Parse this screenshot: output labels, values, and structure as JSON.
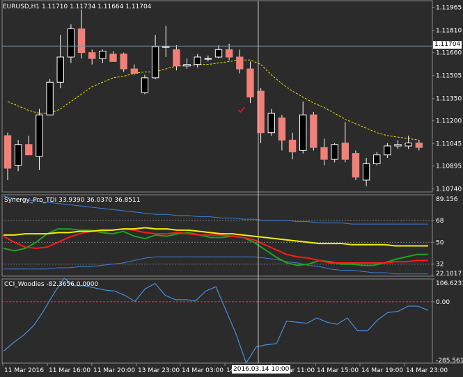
{
  "main_header": {
    "symbol": "EURUSD,H1",
    "ohlc": "1.11710 1.11734 1.11664 1.11704"
  },
  "tdi_header": {
    "name": "Synergy_Pro_TDI",
    "values": "33.9390 36.0370 36.8511"
  },
  "cci_header": {
    "name": "CCI_Woodies",
    "values": "-82.3656 0.0000"
  },
  "current_price_label": "1.11704",
  "cursor_time_label": "2016.03.14 10:00",
  "trade_marker_icon": "checkmark-icon",
  "colors": {
    "background": "#2b2b2b",
    "bull_candle": "#ffffff",
    "bear_candle": "#f08078",
    "ma_line": "#e8e800",
    "tdi_band": "#3d7fd9",
    "tdi_red": "#ff1a1a",
    "tdi_green": "#1fa31f",
    "tdi_yellow": "#f2f200",
    "cci_line": "#4a90d9",
    "zero_line": "#ff3030"
  },
  "chart_data": [
    {
      "type": "candlestick",
      "title": "EURUSD,H1",
      "y_ticks": [
        "1.11965",
        "1.11810",
        "1.11660",
        "1.11505",
        "1.11350",
        "1.11200",
        "1.11045",
        "1.10895",
        "1.10740"
      ],
      "ylim": [
        1.1072,
        1.1201
      ],
      "current_price": 1.11704,
      "x_ticks": [
        "11 Mar 2016",
        "11 Mar 16:00",
        "11 Mar 20:00",
        "13 Mar 23:00",
        "14 Mar 03:00",
        "14 Mar 07:00",
        "14 Mar 11:00",
        "14 Mar 15:00",
        "14 Mar 19:00",
        "14 Mar 23:00"
      ],
      "candles": [
        {
          "o": 1.111,
          "h": 1.1112,
          "l": 1.108,
          "c": 1.1088
        },
        {
          "o": 1.109,
          "h": 1.1107,
          "l": 1.1086,
          "c": 1.1104
        },
        {
          "o": 1.1104,
          "h": 1.111,
          "l": 1.1098,
          "c": 1.1097
        },
        {
          "o": 1.1096,
          "h": 1.1128,
          "l": 1.1087,
          "c": 1.1124
        },
        {
          "o": 1.1124,
          "h": 1.1148,
          "l": 1.1124,
          "c": 1.1146
        },
        {
          "o": 1.1146,
          "h": 1.1178,
          "l": 1.1142,
          "c": 1.1163
        },
        {
          "o": 1.1163,
          "h": 1.1185,
          "l": 1.1159,
          "c": 1.1182
        },
        {
          "o": 1.1182,
          "h": 1.1195,
          "l": 1.1162,
          "c": 1.1166
        },
        {
          "o": 1.1166,
          "h": 1.1168,
          "l": 1.1158,
          "c": 1.1162
        },
        {
          "o": 1.1162,
          "h": 1.1168,
          "l": 1.1159,
          "c": 1.1167
        },
        {
          "o": 1.1165,
          "h": 1.1167,
          "l": 1.116,
          "c": 1.116
        },
        {
          "o": 1.1165,
          "h": 1.1166,
          "l": 1.1153,
          "c": 1.1155
        },
        {
          "o": 1.1155,
          "h": 1.1158,
          "l": 1.1151,
          "c": 1.1152
        },
        {
          "o": 1.1139,
          "h": 1.1151,
          "l": 1.1138,
          "c": 1.1149
        },
        {
          "o": 1.1149,
          "h": 1.1178,
          "l": 1.1148,
          "c": 1.117
        },
        {
          "o": 1.117,
          "h": 1.1184,
          "l": 1.1163,
          "c": 1.117
        },
        {
          "o": 1.1168,
          "h": 1.1171,
          "l": 1.1154,
          "c": 1.1157
        },
        {
          "o": 1.1157,
          "h": 1.1162,
          "l": 1.1155,
          "c": 1.1158
        },
        {
          "o": 1.1158,
          "h": 1.1165,
          "l": 1.1156,
          "c": 1.1163
        },
        {
          "o": 1.1162,
          "h": 1.1164,
          "l": 1.116,
          "c": 1.1162
        },
        {
          "o": 1.1163,
          "h": 1.1171,
          "l": 1.1162,
          "c": 1.1168
        },
        {
          "o": 1.1168,
          "h": 1.1172,
          "l": 1.1161,
          "c": 1.1163
        },
        {
          "o": 1.1163,
          "h": 1.1168,
          "l": 1.1152,
          "c": 1.1155
        },
        {
          "o": 1.1155,
          "h": 1.116,
          "l": 1.1132,
          "c": 1.1136
        },
        {
          "o": 1.114,
          "h": 1.1142,
          "l": 1.1105,
          "c": 1.1112
        },
        {
          "o": 1.1112,
          "h": 1.1128,
          "l": 1.111,
          "c": 1.1125
        },
        {
          "o": 1.1122,
          "h": 1.1124,
          "l": 1.11,
          "c": 1.1107
        },
        {
          "o": 1.1107,
          "h": 1.1112,
          "l": 1.1094,
          "c": 1.1099
        },
        {
          "o": 1.11,
          "h": 1.1133,
          "l": 1.1098,
          "c": 1.1124
        },
        {
          "o": 1.1124,
          "h": 1.1126,
          "l": 1.11,
          "c": 1.1102
        },
        {
          "o": 1.1102,
          "h": 1.1108,
          "l": 1.109,
          "c": 1.1094
        },
        {
          "o": 1.1094,
          "h": 1.1105,
          "l": 1.1092,
          "c": 1.1104
        },
        {
          "o": 1.1105,
          "h": 1.1119,
          "l": 1.1092,
          "c": 1.1094
        },
        {
          "o": 1.1098,
          "h": 1.11,
          "l": 1.108,
          "c": 1.1082
        },
        {
          "o": 1.108,
          "h": 1.1095,
          "l": 1.1076,
          "c": 1.1091
        },
        {
          "o": 1.1091,
          "h": 1.1099,
          "l": 1.109,
          "c": 1.1097
        },
        {
          "o": 1.1097,
          "h": 1.1105,
          "l": 1.1095,
          "c": 1.1103
        },
        {
          "o": 1.1103,
          "h": 1.1107,
          "l": 1.1101,
          "c": 1.1104
        },
        {
          "o": 1.1103,
          "h": 1.111,
          "l": 1.1101,
          "c": 1.1105
        },
        {
          "o": 1.1105,
          "h": 1.1107,
          "l": 1.11,
          "c": 1.1102
        }
      ],
      "ma": [
        1.1133,
        1.113,
        1.1127,
        1.1125,
        1.1125,
        1.1128,
        1.1133,
        1.1138,
        1.1143,
        1.1146,
        1.1149,
        1.115,
        1.1152,
        1.1153,
        1.1153,
        1.1155,
        1.1157,
        1.1157,
        1.1158,
        1.1158,
        1.1159,
        1.116,
        1.1161,
        1.1161,
        1.1158,
        1.1151,
        1.1145,
        1.114,
        1.1136,
        1.1132,
        1.1129,
        1.1125,
        1.1121,
        1.1118,
        1.1115,
        1.1112,
        1.111,
        1.1109,
        1.1108,
        1.1107
      ]
    },
    {
      "type": "line",
      "title": "Synergy_Pro_TDI",
      "y_ticks": [
        "89.156",
        "68",
        "50",
        "32",
        "22.1017"
      ],
      "ylim": [
        22.1017,
        89.156
      ],
      "levels": [
        68,
        50,
        32
      ],
      "series": [
        {
          "name": "upper",
          "values": [
            88,
            86,
            85,
            84,
            83,
            82,
            81,
            80,
            79,
            78,
            77,
            76,
            75,
            74,
            73,
            73,
            72,
            72,
            71,
            71,
            70,
            70,
            69,
            69,
            68,
            68,
            68,
            67,
            67,
            66,
            66,
            66,
            65,
            65,
            65,
            65,
            65,
            65,
            65,
            65
          ]
        },
        {
          "name": "lower",
          "values": [
            28,
            28,
            28,
            28,
            28,
            29,
            29,
            30,
            30,
            31,
            32,
            33,
            35,
            37,
            38,
            38,
            38,
            38,
            38,
            38,
            38,
            38,
            38,
            38,
            37,
            36,
            34,
            33,
            31,
            30,
            28,
            27,
            27,
            26,
            25,
            25,
            24,
            24,
            24,
            24
          ]
        },
        {
          "name": "red",
          "values": [
            55,
            50,
            46,
            45,
            46,
            50,
            54,
            57,
            59,
            59,
            60,
            61,
            60,
            58,
            57,
            57,
            58,
            57,
            56,
            56,
            56,
            55,
            54,
            52,
            48,
            44,
            40,
            38,
            37,
            35,
            33,
            33,
            33,
            33,
            33,
            33,
            34,
            34,
            35,
            35
          ]
        },
        {
          "name": "green",
          "values": [
            45,
            43,
            45,
            50,
            57,
            61,
            61,
            60,
            60,
            58,
            57,
            59,
            55,
            53,
            56,
            55,
            57,
            58,
            56,
            54,
            54,
            55,
            54,
            50,
            44,
            38,
            33,
            31,
            32,
            35,
            34,
            32,
            32,
            31,
            31,
            33,
            36,
            38,
            40,
            40
          ]
        },
        {
          "name": "yellow",
          "values": [
            56,
            56,
            57,
            57,
            57,
            58,
            58,
            59,
            59,
            60,
            60,
            61,
            61,
            62,
            61,
            61,
            60,
            60,
            59,
            58,
            57,
            57,
            56,
            55,
            54,
            53,
            52,
            51,
            50,
            49,
            49,
            49,
            48,
            48,
            48,
            48,
            47,
            47,
            47,
            47
          ]
        }
      ]
    },
    {
      "type": "line",
      "title": "CCI_Woodies",
      "y_ticks": [
        "106.6231",
        "0.00",
        "-285.5616"
      ],
      "ylim": [
        -285.5616,
        106.6231
      ],
      "levels": [
        0
      ],
      "series": [
        {
          "name": "cci",
          "values": [
            -230,
            -190,
            -155,
            -110,
            -40,
            40,
            110,
            75,
            75,
            65,
            55,
            50,
            30,
            2,
            60,
            85,
            30,
            10,
            10,
            5,
            50,
            70,
            -40,
            -150,
            -285,
            -210,
            -200,
            -195,
            -90,
            -95,
            -100,
            -75,
            -95,
            -105,
            -75,
            -135,
            -135,
            -85,
            -50,
            -45,
            -20,
            -20,
            -40
          ]
        }
      ]
    }
  ]
}
